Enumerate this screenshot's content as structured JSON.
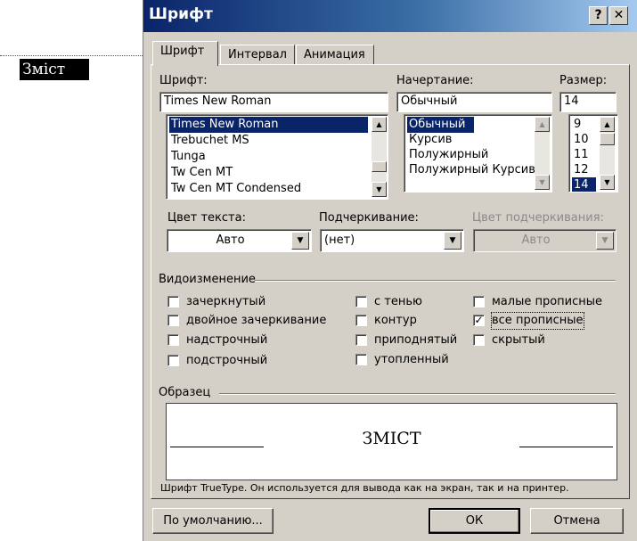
{
  "document": {
    "heading": "Зміст"
  },
  "dialog": {
    "title": "Шрифт",
    "help_label": "?",
    "close_label": "✕"
  },
  "tabs": [
    "Шрифт",
    "Интервал",
    "Анимация"
  ],
  "font": {
    "label": "Шрифт:",
    "value": "Times New Roman",
    "items": [
      "Times New Roman",
      "Trebuchet MS",
      "Tunga",
      "Tw Cen MT",
      "Tw Cen MT Condensed"
    ],
    "selected": "Times New Roman"
  },
  "style": {
    "label": "Начертание:",
    "value": "Обычный",
    "items": [
      "Обычный",
      "Курсив",
      "Полужирный",
      "Полужирный Курсив"
    ],
    "selected": "Обычный"
  },
  "size": {
    "label": "Размер:",
    "value": "14",
    "items": [
      "9",
      "10",
      "11",
      "12",
      "14"
    ],
    "selected": "14"
  },
  "text_color": {
    "label": "Цвет текста:",
    "value": "Авто"
  },
  "underline": {
    "label": "Подчеркивание:",
    "value": "(нет)"
  },
  "underline_color": {
    "label": "Цвет подчеркивания:",
    "value": "Авто"
  },
  "effects": {
    "label": "Видоизменение",
    "options": [
      {
        "label": "зачеркнутый",
        "checked": false
      },
      {
        "label": "двойное зачеркивание",
        "checked": false
      },
      {
        "label": "надстрочный",
        "checked": false
      },
      {
        "label": "подстрочный",
        "checked": false
      },
      {
        "label": "с тенью",
        "checked": false
      },
      {
        "label": "контур",
        "checked": false
      },
      {
        "label": "приподнятый",
        "checked": false
      },
      {
        "label": "утопленный",
        "checked": false
      },
      {
        "label": "малые прописные",
        "checked": false
      },
      {
        "label": "все прописные",
        "checked": true
      },
      {
        "label": "скрытый",
        "checked": false
      }
    ]
  },
  "preview": {
    "label": "Образец",
    "text": "ЗМІСТ",
    "note": "Шрифт TrueType. Он используется для вывода как на экран, так и на принтер."
  },
  "buttons": {
    "default": "По умолчанию...",
    "ok": "ОК",
    "cancel": "Отмена"
  },
  "colors": {
    "title_start": "#0a246a",
    "title_end": "#a6caf0",
    "selection": "#0a246a",
    "face": "#d4d0c8"
  }
}
